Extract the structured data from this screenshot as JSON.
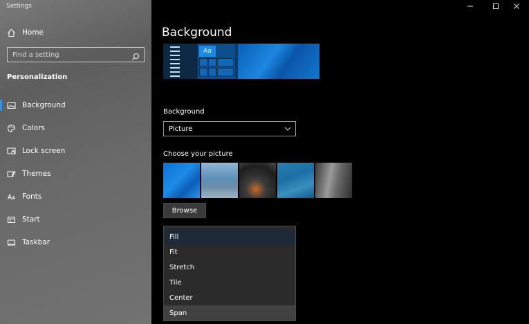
{
  "window": {
    "title": "Settings",
    "controls": [
      "minimize",
      "maximize",
      "close"
    ]
  },
  "sidebar": {
    "home_label": "Home",
    "search": {
      "placeholder": "Find a setting"
    },
    "section_heading": "Personalization",
    "items": [
      {
        "label": "Background",
        "icon": "picture-icon",
        "active": true
      },
      {
        "label": "Colors",
        "icon": "palette-icon",
        "active": false
      },
      {
        "label": "Lock screen",
        "icon": "lock-screen-icon",
        "active": false
      },
      {
        "label": "Themes",
        "icon": "themes-icon",
        "active": false
      },
      {
        "label": "Fonts",
        "icon": "fonts-icon",
        "active": false
      },
      {
        "label": "Start",
        "icon": "start-icon",
        "active": false
      },
      {
        "label": "Taskbar",
        "icon": "taskbar-icon",
        "active": false
      }
    ]
  },
  "main": {
    "title": "Background",
    "preview": {
      "sample_text": "Aa"
    },
    "background_label": "Background",
    "background_value": "Picture",
    "choose_picture_label": "Choose your picture",
    "browse_label": "Browse",
    "fit_options": [
      {
        "label": "Fill",
        "state": "selected"
      },
      {
        "label": "Fit",
        "state": "normal"
      },
      {
        "label": "Stretch",
        "state": "normal"
      },
      {
        "label": "Tile",
        "state": "normal"
      },
      {
        "label": "Center",
        "state": "normal"
      },
      {
        "label": "Span",
        "state": "hover"
      }
    ]
  },
  "colors": {
    "accent": "#3a8fd8",
    "sidebar_bg": "#6a6a6a",
    "main_bg": "#000000",
    "dropdown_bg": "#2b2b2b"
  }
}
